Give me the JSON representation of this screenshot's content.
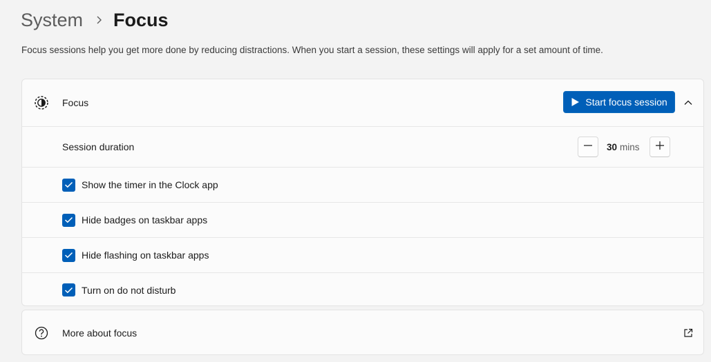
{
  "breadcrumb": {
    "parent": "System",
    "current": "Focus"
  },
  "description": "Focus sessions help you get more done by reducing distractions. When you start a session, these settings will apply for a set amount of time.",
  "focus_card": {
    "title": "Focus",
    "icon": "focus-icon",
    "start_button_label": "Start focus session",
    "expanded": true,
    "session_duration": {
      "label": "Session duration",
      "value": "30",
      "unit": "mins"
    },
    "options": [
      {
        "label": "Show the timer in the Clock app",
        "checked": true
      },
      {
        "label": "Hide badges on taskbar apps",
        "checked": true
      },
      {
        "label": "Hide flashing on taskbar apps",
        "checked": true
      },
      {
        "label": "Turn on do not disturb",
        "checked": true
      }
    ]
  },
  "more_card": {
    "label": "More about focus",
    "icon": "help-icon",
    "link_icon": "external-link-icon"
  },
  "colors": {
    "accent": "#005fb8",
    "background": "#f3f3f3",
    "card": "#fbfbfb"
  }
}
